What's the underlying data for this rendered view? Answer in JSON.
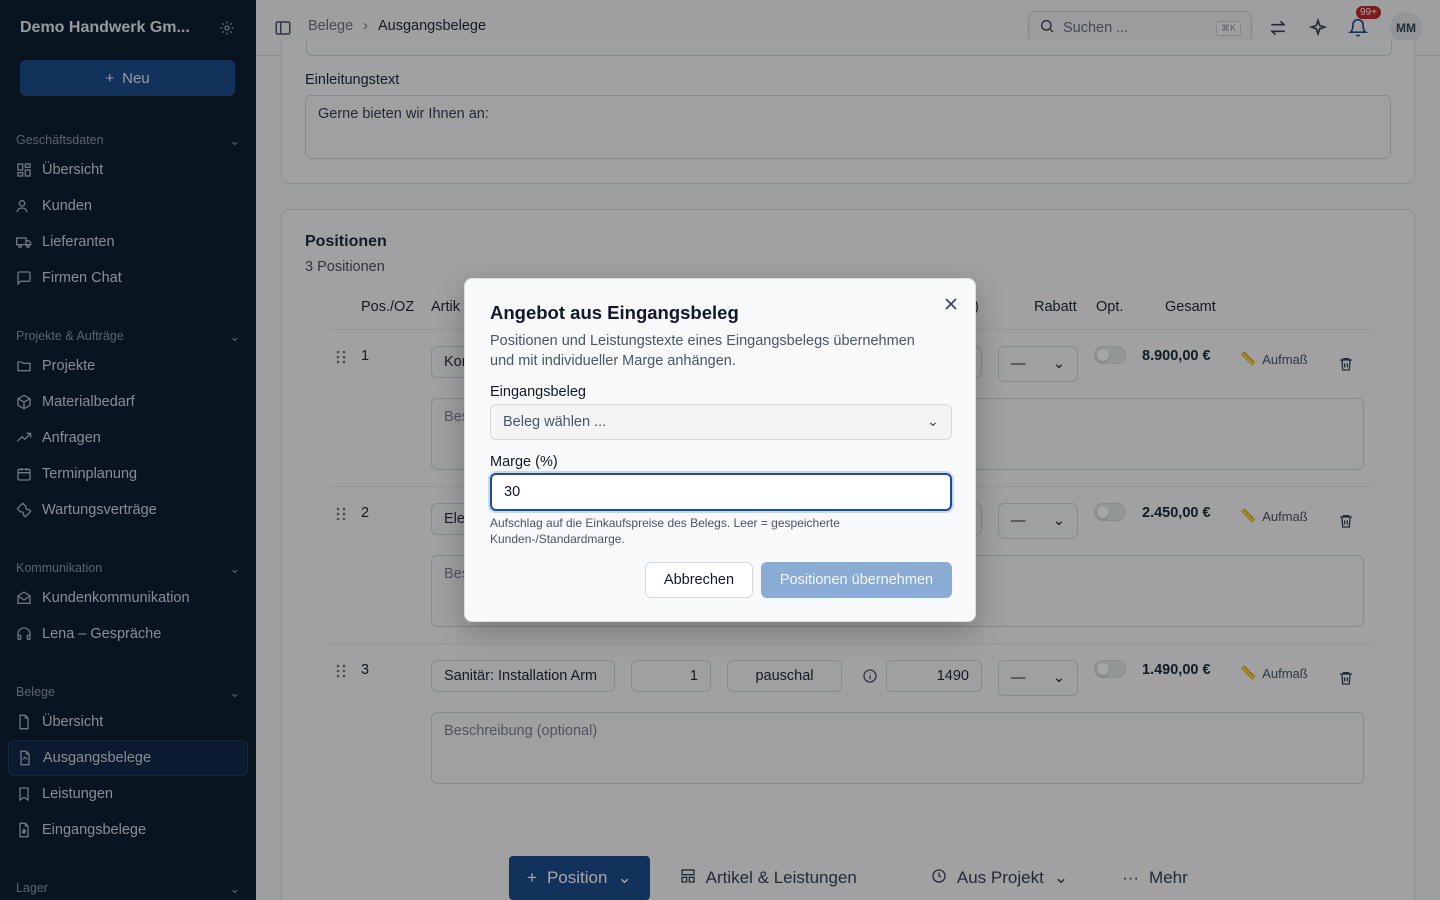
{
  "sidebar": {
    "company": "Demo Handwerk Gm...",
    "new_label": "Neu",
    "sections": [
      {
        "title": "Geschäftsdaten",
        "items": [
          {
            "label": "Übersicht",
            "icon": "grid-icon"
          },
          {
            "label": "Kunden",
            "icon": "users-icon"
          },
          {
            "label": "Lieferanten",
            "icon": "truck-icon"
          },
          {
            "label": "Firmen Chat",
            "icon": "chat-icon"
          }
        ]
      },
      {
        "title": "Projekte & Aufträge",
        "items": [
          {
            "label": "Projekte",
            "icon": "folder-icon"
          },
          {
            "label": "Materialbedarf",
            "icon": "package-icon"
          },
          {
            "label": "Anfragen",
            "icon": "trending-icon"
          },
          {
            "label": "Terminplanung",
            "icon": "calendar-icon"
          },
          {
            "label": "Wartungsverträge",
            "icon": "wrench-icon"
          }
        ]
      },
      {
        "title": "Kommunikation",
        "items": [
          {
            "label": "Kundenkommunikation",
            "icon": "mail-open-icon"
          },
          {
            "label": "Lena – Gespräche",
            "icon": "headset-icon"
          }
        ]
      },
      {
        "title": "Belege",
        "items": [
          {
            "label": "Übersicht",
            "icon": "file-icon"
          },
          {
            "label": "Ausgangsbelege",
            "icon": "file-out-icon"
          },
          {
            "label": "Leistungen",
            "icon": "bookmark-icon"
          },
          {
            "label": "Eingangsbelege",
            "icon": "file-dollar-icon"
          }
        ]
      },
      {
        "title": "Lager",
        "items": []
      }
    ]
  },
  "topbar": {
    "breadcrumb": [
      "Belege",
      "Ausgangsbelege"
    ],
    "search_placeholder": "Suchen ...",
    "search_shortcut": "⌘K",
    "notification_count": "99+",
    "avatar_initials": "MM"
  },
  "intro": {
    "label": "Einleitungstext",
    "text": "Gerne bieten wir Ihnen an:"
  },
  "positions": {
    "title": "Positionen",
    "count_text": "3 Positionen",
    "headers": {
      "pos": "Pos./OZ",
      "article": "Artik",
      "price_suffix": ")",
      "discount": "Rabatt",
      "optional": "Opt.",
      "total": "Gesamt"
    },
    "rows": [
      {
        "num": "1",
        "name": "Kon",
        "desc_placeholder": "Bes",
        "discount": "—",
        "total": "8.900,00 €",
        "aufmass": "Aufmaß"
      },
      {
        "num": "2",
        "name": "Ele",
        "desc_placeholder": "Bes",
        "discount": "—",
        "total": "2.450,00 €",
        "aufmass": "Aufmaß"
      },
      {
        "num": "3",
        "name": "Sanitär: Installation Arm",
        "qty": "1",
        "unit": "pauschal",
        "price": "1490",
        "desc_placeholder": "Beschreibung (optional)",
        "discount": "—",
        "total": "1.490,00 €",
        "aufmass": "Aufmaß"
      }
    ],
    "actions": {
      "add_position": "Position",
      "articles": "Artikel & Leistungen",
      "from_project": "Aus Projekt",
      "more": "Mehr"
    }
  },
  "dialog": {
    "title": "Angebot aus Eingangsbeleg",
    "description": "Positionen und Leistungstexte eines Eingangsbelegs übernehmen und mit individueller Marge anhängen.",
    "receipt_label": "Eingangsbeleg",
    "receipt_placeholder": "Beleg wählen ...",
    "margin_label": "Marge (%)",
    "margin_value": "30",
    "hint": "Aufschlag auf die Einkaufspreise des Belegs. Leer = gespeicherte Kunden-/Standardmarge.",
    "cancel_label": "Abbrechen",
    "submit_label": "Positionen übernehmen"
  }
}
